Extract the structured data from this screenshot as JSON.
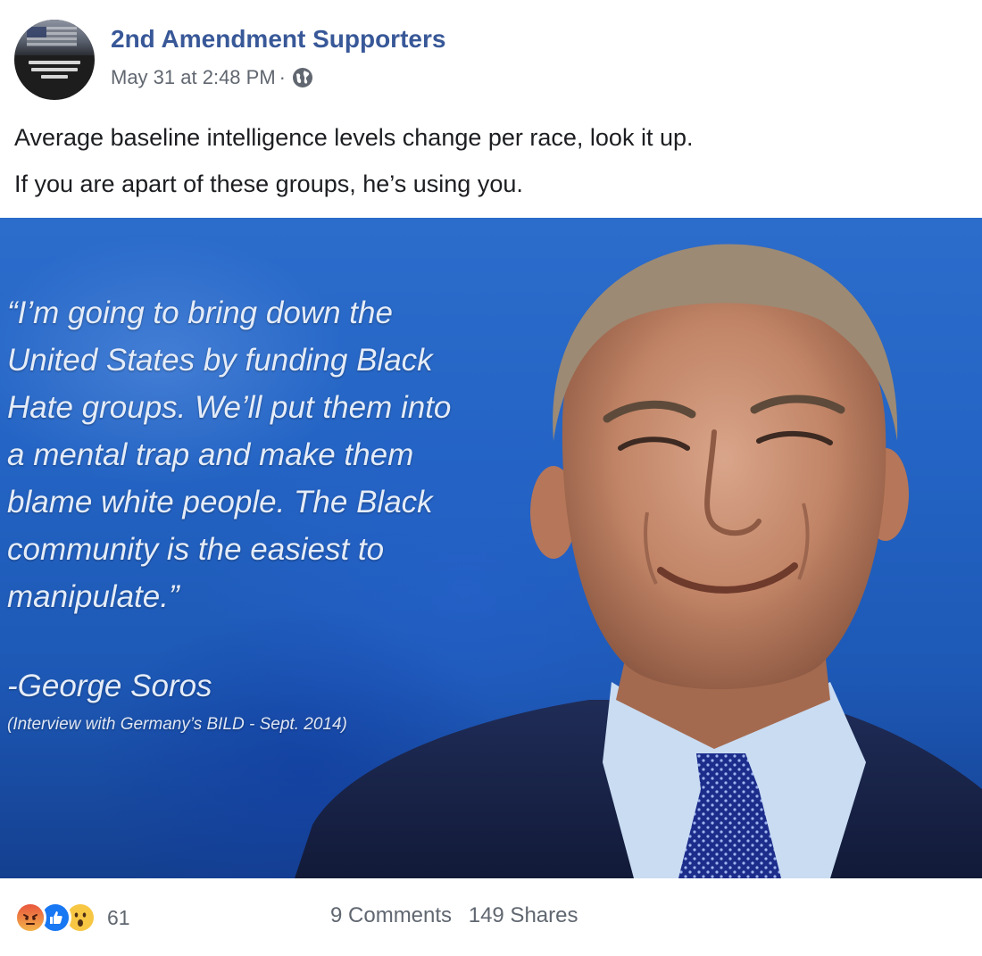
{
  "post": {
    "page_name": "2nd Amendment Supporters",
    "timestamp": "May 31 at 2:48 PM",
    "separator": "·",
    "privacy_icon": "globe-icon",
    "avatar_icon": "page-avatar",
    "text_lines": [
      "Average baseline intelligence levels change per race, look it up.",
      "If you are apart of these groups, he’s using you."
    ]
  },
  "image": {
    "quote_lines": [
      "“I’m going to bring down the",
      "United States by funding Black",
      "Hate groups. We’ll put them into",
      "a mental trap and make them",
      "blame white people. The Black",
      "community is the easiest to",
      "manipulate.”"
    ],
    "attribution": "-George Soros",
    "source": "(Interview with Germany’s BILD  - Sept. 2014)",
    "background_color": "#2464c4"
  },
  "footer": {
    "reactions": [
      "angry-icon",
      "like-icon",
      "wow-icon"
    ],
    "reaction_count": "61",
    "comments": "9 Comments",
    "shares": "149 Shares"
  }
}
